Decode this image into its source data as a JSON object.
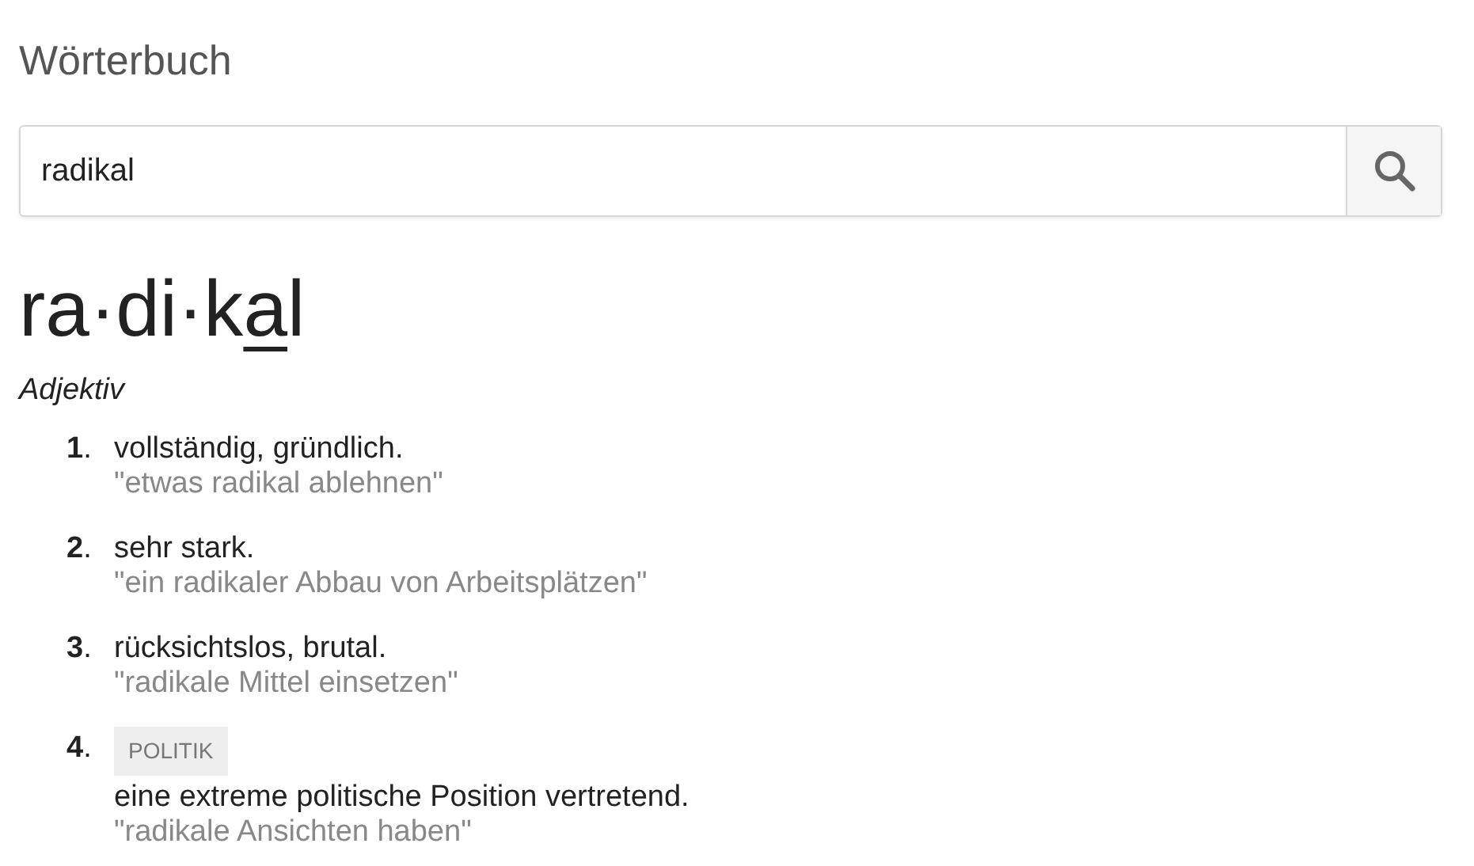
{
  "title": "Wörterbuch",
  "search": {
    "value": "radikal"
  },
  "headword": [
    {
      "text": "ra·di·k",
      "stressed": false
    },
    {
      "text": "a",
      "stressed": true
    },
    {
      "text": "l",
      "stressed": false
    }
  ],
  "part_of_speech": "Adjektiv",
  "senses": [
    {
      "number": "**1**.",
      "definition": "vollständig, gründlich.",
      "example": "\"etwas radikal ablehnen\""
    },
    {
      "number": "**2**.",
      "definition": "sehr stark.",
      "example": "\"ein radikaler Abbau von Arbeitsplätzen\""
    },
    {
      "number": "**3**.",
      "definition": "rücksichtslos, brutal.",
      "example": "\"radikale Mittel einsetzen\""
    },
    {
      "number": "**4**.",
      "tag": "POLITIK",
      "definition": "eine extreme politische Position vertretend.",
      "example": "\"radikale Ansichten haben\""
    }
  ]
}
